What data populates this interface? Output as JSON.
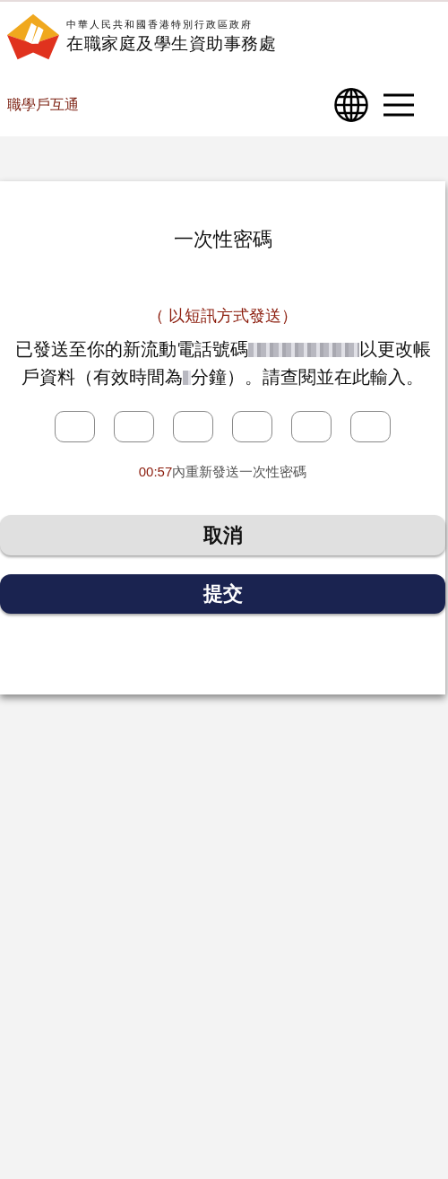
{
  "header": {
    "org_line": "中華人民共和國香港特別行政區政府",
    "org_name": "在職家庭及學生資助事務處",
    "site_name": "職學戶互通"
  },
  "card": {
    "title": "一次性密碼",
    "subtitle": "（ 以短訊方式發送）",
    "message_lines": [
      [
        {
          "kind": "text",
          "text": "已發送至你的新流動電話號碼"
        },
        {
          "kind": "redacted_number"
        },
        {
          "kind": "text",
          "text": "以更改帳"
        }
      ],
      [
        {
          "kind": "text",
          "text": "戶資料（有效時間為"
        },
        {
          "kind": "redacted_digit"
        },
        {
          "kind": "text",
          "text": "分鐘）。請查閱並在此輸入。"
        }
      ]
    ],
    "timer": {
      "countdown": "00:57",
      "text": "內重新發送一次性密碼"
    },
    "buttons": [
      {
        "label": "取消",
        "kind": "secondary"
      },
      {
        "label": "提交",
        "kind": "primary"
      }
    ]
  }
}
